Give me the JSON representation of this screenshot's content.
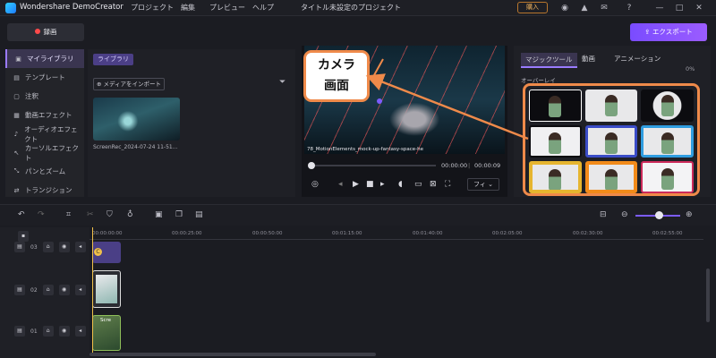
{
  "app": {
    "name": "Wondershare DemoCreator",
    "document_title": "タイトル未設定のプロジェクト",
    "buy_label": "購入"
  },
  "menu": [
    "プロジェクト",
    "編集",
    "プレビュー",
    "ヘルプ"
  ],
  "toolbar": {
    "record_label": "録画",
    "export_label": "エクスポート"
  },
  "sidebar": {
    "items": [
      {
        "label": "マイライブラリ",
        "icon": "folder-icon",
        "active": true
      },
      {
        "label": "テンプレート",
        "icon": "template-icon"
      },
      {
        "label": "注釈",
        "icon": "annotation-icon"
      },
      {
        "label": "動画エフェクト",
        "icon": "effect-icon"
      },
      {
        "label": "オーディオエフェクト",
        "icon": "music-icon"
      },
      {
        "label": "カーソルエフェクト",
        "icon": "cursor-icon"
      },
      {
        "label": "パンとズーム",
        "icon": "pan-zoom-icon"
      },
      {
        "label": "トランジション",
        "icon": "transition-icon"
      }
    ]
  },
  "library": {
    "tab": "ライブラリ",
    "import_label": "メディアをインポート",
    "media": [
      {
        "name": "ScreenRec_2024-07-24 11-51..."
      }
    ]
  },
  "preview": {
    "caption": "78_MotionElements_mock-up-fantasy-space-he",
    "current_time": "00:00:00",
    "total_time": "00:00:09",
    "fit_label": "フィ",
    "callout": [
      "カメラ",
      "画面"
    ]
  },
  "right_panel": {
    "tabs": [
      "マジックツール",
      "動画",
      "アニメーション"
    ],
    "section_label": "オーバーレイ",
    "percent": "0%"
  },
  "timeline": {
    "ruler": [
      "00:00:00:00",
      "00:00:25:00",
      "00:00:50:00",
      "00:01:15:00",
      "00:01:40:00",
      "00:02:05:00",
      "00:02:30:00",
      "00:02:55:00"
    ],
    "tracks": [
      {
        "number": "03"
      },
      {
        "number": "02"
      },
      {
        "number": "01"
      }
    ],
    "clip_label": "Scre"
  },
  "colors": {
    "accent": "#9b5cff",
    "callout": "#ef8a4a",
    "playhead": "#f0c04a"
  }
}
